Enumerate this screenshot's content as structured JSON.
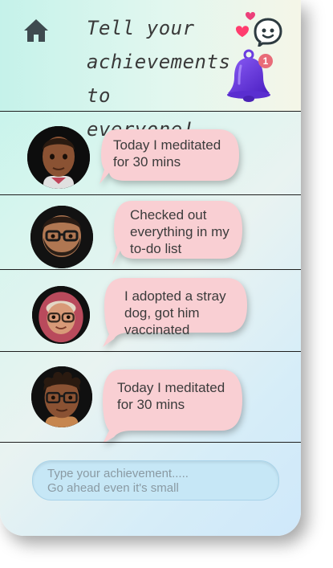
{
  "header": {
    "title": "Tell your achievements to everyone!",
    "notification_count": "1",
    "icons": [
      "home-icon",
      "hearts-chat-icon",
      "bell-icon"
    ]
  },
  "feed": [
    {
      "avatar": "avatar-man-braids",
      "text": "Today I meditated for 30 mins"
    },
    {
      "avatar": "avatar-man-beard-glasses",
      "text": "Checked out everything in my to-do list"
    },
    {
      "avatar": "avatar-woman-hijab-glasses",
      "text": "I adopted a stray dog, got him vaccinated"
    },
    {
      "avatar": "avatar-man-curly-glasses",
      "text": "Today I meditated for 30 mins"
    }
  ],
  "composer": {
    "placeholder": "Type your achievement.....\nGo ahead even it's small"
  },
  "colors": {
    "bubble": "#f9cfd3",
    "bell": "#6a3ce0",
    "badge": "#e86b78",
    "composer": "#c6e7f6"
  }
}
